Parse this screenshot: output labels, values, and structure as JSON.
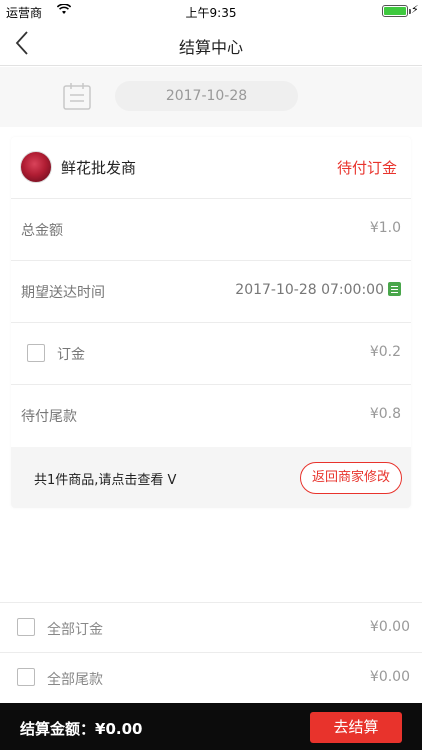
{
  "status_bar": {
    "carrier": "运营商",
    "time": "上午9:35",
    "wifi_icon": "wifi-icon",
    "battery_icon": "battery-icon",
    "battery_level": 1.0,
    "charging_icon": "bolt-icon"
  },
  "nav": {
    "title": "结算中心",
    "back_icon": "chevron-left-icon"
  },
  "date_picker": {
    "icon": "calendar-icon",
    "value": "2017-10-28"
  },
  "order": {
    "shop_name": "鲜花批发商",
    "status": "待付订金",
    "total_label": "总金额",
    "total_value": "¥1.0",
    "delivery_label": "期望送达时间",
    "delivery_value": "2017-10-28 07:00:00",
    "deposit_label": "订金",
    "deposit_value": "¥0.2",
    "balance_label": "待付尾款",
    "balance_value": "¥0.8",
    "summary_text": "共1件商品,请点击查看 V",
    "edit_button": "返回商家修改"
  },
  "all_options": {
    "deposit_label": "全部订金",
    "deposit_value": "¥0.00",
    "balance_label": "全部尾款",
    "balance_value": "¥0.00"
  },
  "footer": {
    "total_label": "结算金额：¥0.00",
    "checkout_button": "去结算"
  },
  "colors": {
    "accent": "#e8332c",
    "footer_bg": "#0c0c0c",
    "calendar_green": "#49a64b"
  }
}
